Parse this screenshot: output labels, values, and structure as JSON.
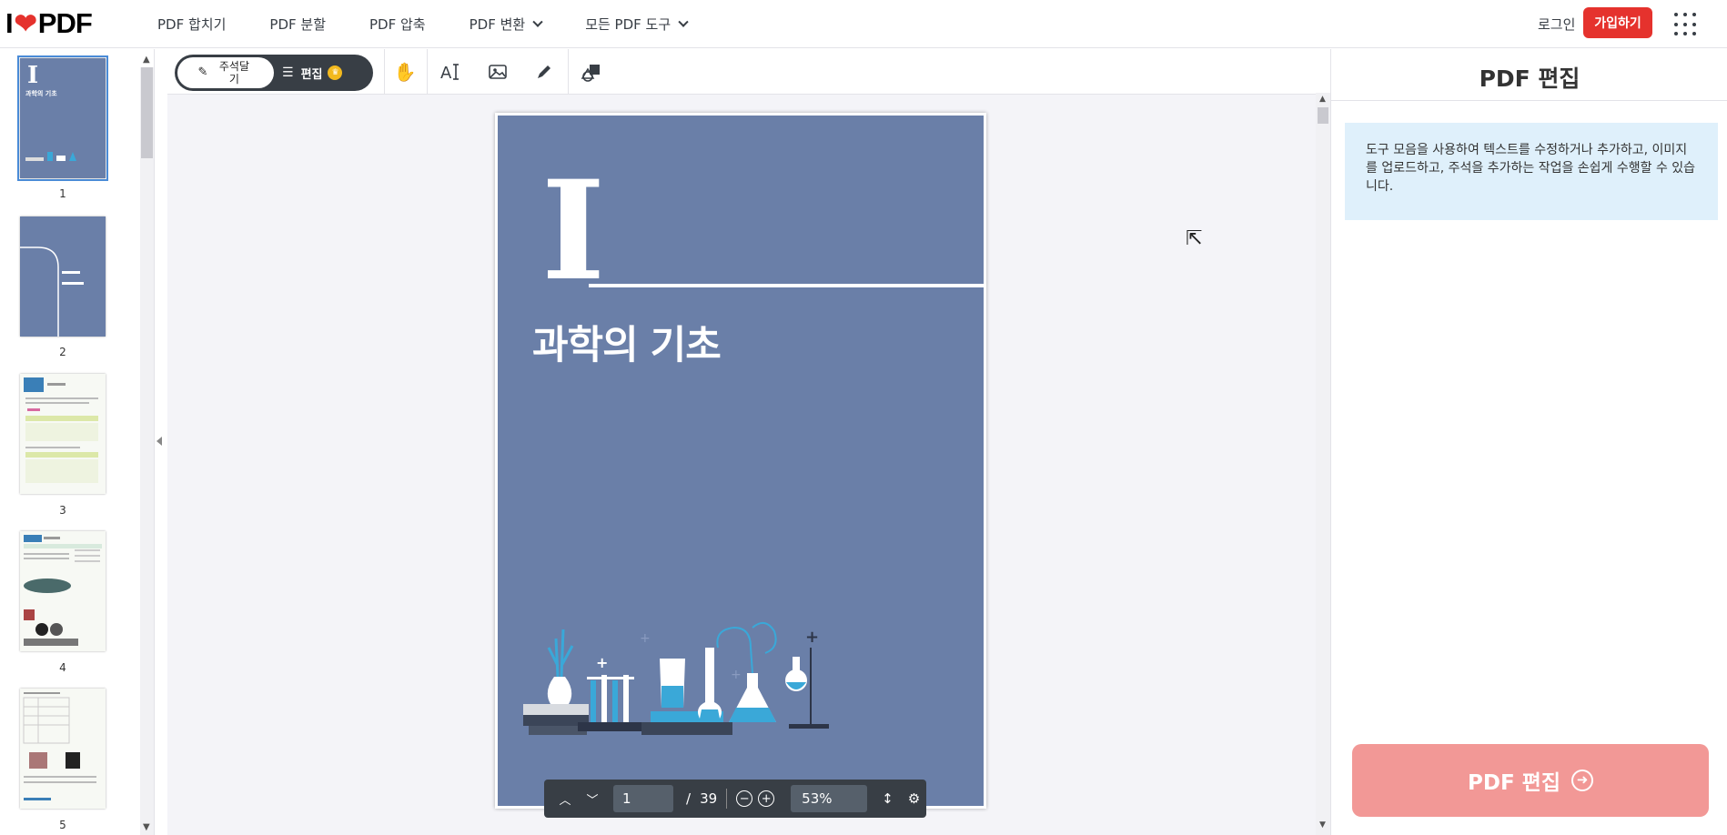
{
  "header": {
    "logo_left": "I",
    "logo_heart": "❤",
    "logo_right": "PDF",
    "nav": [
      {
        "label": "PDF 합치기"
      },
      {
        "label": "PDF 분할"
      },
      {
        "label": "PDF 압축"
      },
      {
        "label": "PDF 변환"
      },
      {
        "label": "모든 PDF 도구"
      }
    ],
    "login": "로그인",
    "signup": "가입하기"
  },
  "thumbnails": [
    {
      "page": "1",
      "title": "과학의 기초",
      "roman": "I"
    },
    {
      "page": "2"
    },
    {
      "page": "3"
    },
    {
      "page": "4"
    },
    {
      "page": "5"
    }
  ],
  "toolbar": {
    "annotate_label": "주석달 기",
    "edit_label": "편집"
  },
  "document": {
    "roman": "I",
    "title": "과학의 기초"
  },
  "pager": {
    "current_page": "1",
    "separator": "/",
    "total_pages": "39",
    "zoom": "53%"
  },
  "panel": {
    "title": "PDF 편집",
    "info": "도구 모음을 사용하여 텍스트를 수정하거나 추가하고, 이미지를 업로드하고, 주석을 추가하는 작업을 손쉽게 수행할 수 있습니다.",
    "cta": "PDF 편집"
  },
  "colors": {
    "brand": "#e5322d",
    "cover": "#6a7fa8",
    "dark": "#383e45",
    "info_bg": "#dff0fb",
    "cta_disabled": "#f29896"
  }
}
